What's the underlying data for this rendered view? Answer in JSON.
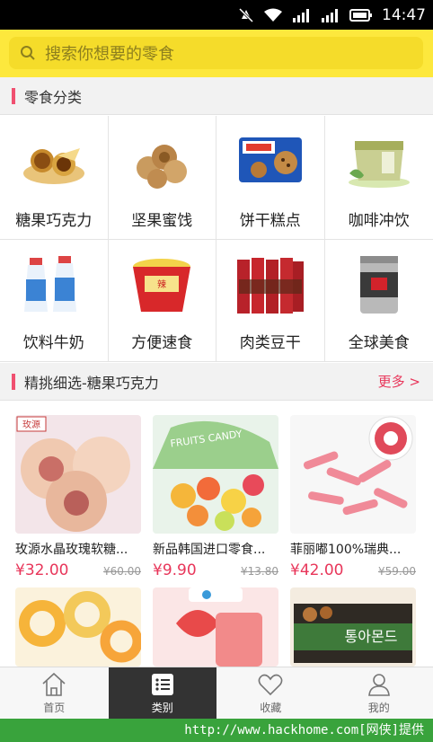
{
  "status_bar": {
    "time": "14:47"
  },
  "search": {
    "placeholder": "搜索你想要的零食"
  },
  "categories_section": {
    "title": "零食分类"
  },
  "categories": [
    {
      "label": "糖果巧克力",
      "icon": "chocolate-candy-icon"
    },
    {
      "label": "坚果蜜饯",
      "icon": "walnut-icon"
    },
    {
      "label": "饼干糕点",
      "icon": "cookie-pack-icon"
    },
    {
      "label": "咖啡冲饮",
      "icon": "tea-box-icon"
    },
    {
      "label": "饮料牛奶",
      "icon": "yogurt-bottle-icon"
    },
    {
      "label": "方便速食",
      "icon": "instant-noodle-icon"
    },
    {
      "label": "肉类豆干",
      "icon": "meat-snack-icon"
    },
    {
      "label": "全球美食",
      "icon": "coffee-can-icon"
    }
  ],
  "featured_section": {
    "title": "精挑细选-糖果巧克力",
    "more": "更多 >"
  },
  "products": [
    {
      "name": "玫源水晶玫瑰软糖...",
      "price": "¥32.00",
      "old_price": "¥60.00",
      "badge": "玫源"
    },
    {
      "name": "新品韩国进口零食...",
      "price": "¥9.90",
      "old_price": "¥13.80",
      "badge": "FRUITS CANDY"
    },
    {
      "name": "菲丽嘟100%瑞典...",
      "price": "¥42.00",
      "old_price": "¥59.00",
      "badge": ""
    },
    {
      "name": "",
      "price": "",
      "old_price": "",
      "badge": ""
    },
    {
      "name": "",
      "price": "",
      "old_price": "",
      "badge": ""
    },
    {
      "name": "",
      "price": "",
      "old_price": "",
      "badge": "통아몬드"
    }
  ],
  "tabs": [
    {
      "label": "首页",
      "icon": "home-icon",
      "active": false
    },
    {
      "label": "类别",
      "icon": "list-icon",
      "active": true
    },
    {
      "label": "收藏",
      "icon": "heart-icon",
      "active": false
    },
    {
      "label": "我的",
      "icon": "user-icon",
      "active": false
    }
  ],
  "watermark": "http://www.hackhome.com[网侠]提供",
  "colors": {
    "accent": "#e8365a",
    "header": "#fde83d",
    "active_tab": "#333333"
  }
}
